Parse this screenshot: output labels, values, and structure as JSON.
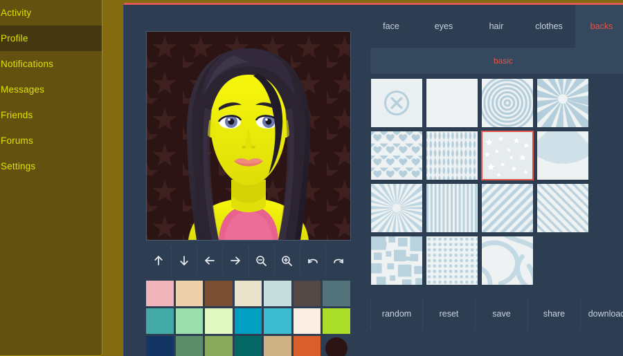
{
  "sidebar": {
    "items": [
      {
        "label": "Activity",
        "active": false
      },
      {
        "label": "Profile",
        "active": true
      },
      {
        "label": "Notifications",
        "active": false
      },
      {
        "label": "Messages",
        "active": false
      },
      {
        "label": "Friends",
        "active": false
      },
      {
        "label": "Forums",
        "active": false
      },
      {
        "label": "Settings",
        "active": false
      }
    ],
    "colors": {
      "bg": "#63510f",
      "text": "#e3e000",
      "active_bg": "#453810",
      "page_bg": "#856b10"
    }
  },
  "panel": {
    "colors": {
      "bg": "#2e3e52",
      "top_accent": "#e05a51",
      "tab_active_bg": "#36485e",
      "accent_red": "#e0564b"
    }
  },
  "avatar": {
    "description": "cartoon female avatar, yellow skin, long dark wavy hair, blue eyes, pink lips, pink tank top",
    "background_color": "#2b1413",
    "background_pattern": "stars",
    "skin_color": "#f2f20a",
    "hair_color": "#2b2430",
    "eye_color": "#6b79b0",
    "lips_color": "#f08a7a",
    "shirt_color": "#e8628f"
  },
  "toolbar": {
    "buttons": [
      {
        "name": "move-up",
        "icon": "arrow-up-icon"
      },
      {
        "name": "move-down",
        "icon": "arrow-down-icon"
      },
      {
        "name": "move-left",
        "icon": "arrow-left-icon"
      },
      {
        "name": "move-right",
        "icon": "arrow-right-icon"
      },
      {
        "name": "zoom-out",
        "icon": "zoom-out-icon"
      },
      {
        "name": "zoom-in",
        "icon": "zoom-in-icon"
      },
      {
        "name": "undo",
        "icon": "undo-icon"
      },
      {
        "name": "redo",
        "icon": "redo-icon"
      }
    ]
  },
  "palette": {
    "colors": [
      "#f0b5bb",
      "#edcfa9",
      "#7a4e33",
      "#e8e2cb",
      "#c5dedd",
      "#534845",
      "#53737b",
      "#44aaa8",
      "#9cdfae",
      "#e1f8c3",
      "#039fc0",
      "#3cbcce",
      "#faeee2",
      "#aade2a",
      "#143563",
      "#5d8e6b",
      "#88a95a",
      "#056764",
      "#ceb184",
      "#d95f2d"
    ],
    "selected_color": "#2b1413"
  },
  "picker": {
    "tabs": [
      {
        "label": "face",
        "active": false
      },
      {
        "label": "eyes",
        "active": false
      },
      {
        "label": "hair",
        "active": false
      },
      {
        "label": "clothes",
        "active": false
      },
      {
        "label": "backs",
        "active": true
      }
    ],
    "subtabs": [
      {
        "label": "basic",
        "active": true
      }
    ],
    "thumbnails": [
      {
        "name": "none",
        "pattern": "none-x",
        "selected": false
      },
      {
        "name": "blank",
        "pattern": "blank",
        "selected": false
      },
      {
        "name": "concentric-circles",
        "pattern": "rings",
        "selected": false
      },
      {
        "name": "sunburst",
        "pattern": "sunburst",
        "selected": false
      },
      {
        "name": "hearts",
        "pattern": "hearts",
        "selected": false
      },
      {
        "name": "diamonds",
        "pattern": "diamonds",
        "selected": false
      },
      {
        "name": "stars",
        "pattern": "stars",
        "selected": true
      },
      {
        "name": "rays-up",
        "pattern": "rays",
        "selected": false
      },
      {
        "name": "starburst",
        "pattern": "starburst",
        "selected": false
      },
      {
        "name": "vertical-stripes",
        "pattern": "vstripes",
        "selected": false
      },
      {
        "name": "diagonal-stripes",
        "pattern": "diag1",
        "selected": false
      },
      {
        "name": "diagonal-stripes-thin",
        "pattern": "diag2",
        "selected": false
      },
      {
        "name": "pixel-squares",
        "pattern": "squares",
        "selected": false
      },
      {
        "name": "polka-dots",
        "pattern": "dots",
        "selected": false
      },
      {
        "name": "curves",
        "pattern": "curves",
        "selected": false
      }
    ],
    "pattern_color": "#b4cfdb",
    "pattern_bg": "#eaeff1"
  },
  "actions": {
    "buttons": [
      {
        "label": "random"
      },
      {
        "label": "reset"
      },
      {
        "label": "save"
      },
      {
        "label": "share"
      },
      {
        "label": "download"
      }
    ]
  }
}
